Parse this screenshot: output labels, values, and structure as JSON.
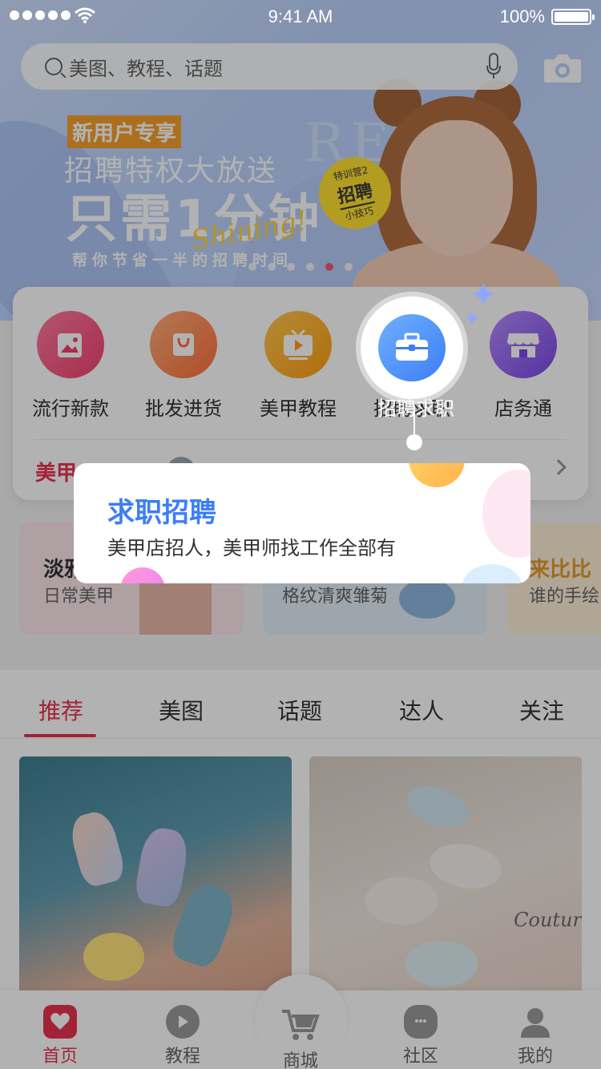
{
  "status_bar": {
    "time": "9:41 AM",
    "battery": "100%"
  },
  "search": {
    "placeholder": "美图、教程、话题"
  },
  "banner": {
    "badge": "新用户专享",
    "promo": "招聘特权大放送",
    "headline": "只需1分钟",
    "script": "Shining!",
    "sub": "帮你节省一半的招聘时间",
    "watermark": "RE  IT",
    "sticker_top": "特训营2",
    "sticker_main": "招聘",
    "sticker_bottom": "小技巧"
  },
  "categories": [
    {
      "label": "流行新款",
      "icon": "gallery-icon"
    },
    {
      "label": "批发进货",
      "icon": "shopping-bag-icon"
    },
    {
      "label": "美甲教程",
      "icon": "tv-icon"
    },
    {
      "label": "招聘求职",
      "icon": "briefcase-icon"
    },
    {
      "label": "店务通",
      "icon": "store-icon"
    }
  ],
  "news": {
    "title": "美甲..."
  },
  "promo_cards": [
    {
      "title": "淡雅",
      "subtitle": "日常美甲"
    },
    {
      "title": "",
      "subtitle": "格纹清爽雏菊"
    },
    {
      "title": "来比比",
      "subtitle": "谁的手绘"
    }
  ],
  "tabs": [
    "推荐",
    "美图",
    "话题",
    "达人",
    "关注"
  ],
  "feed_watermark": "Coutur",
  "bottom_nav": [
    {
      "label": "首页",
      "icon": "heart-icon"
    },
    {
      "label": "教程",
      "icon": "play-icon"
    },
    {
      "label": "商城",
      "icon": "cart-icon"
    },
    {
      "label": "社区",
      "icon": "chat-icon"
    },
    {
      "label": "我的",
      "icon": "user-icon"
    }
  ],
  "tooltip": {
    "title": "求职招聘",
    "description": "美甲店招人，美甲师找工作全部有"
  },
  "colors": {
    "accent": "#e8334f",
    "blue": "#3d7ef4"
  }
}
